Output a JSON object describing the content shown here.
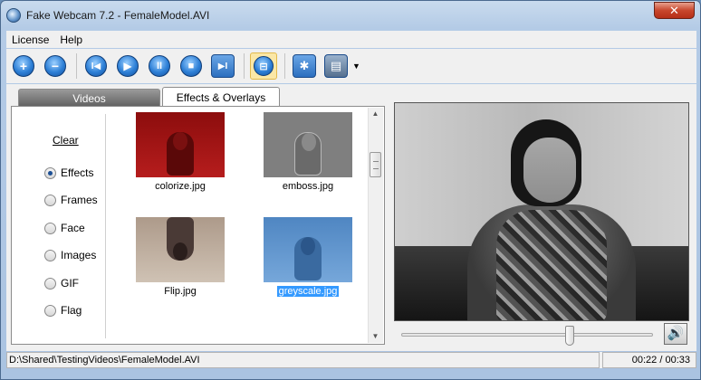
{
  "window": {
    "title": "Fake Webcam 7.2 - FemaleModel.AVI",
    "close_label": "✕"
  },
  "menu": {
    "items": [
      {
        "label": "License"
      },
      {
        "label": "Help"
      }
    ]
  },
  "toolbar": {
    "icons": [
      "add-icon",
      "remove-icon",
      "previous-icon",
      "play-icon",
      "pause-icon",
      "stop-icon",
      "next-icon",
      "fit-icon",
      "settings-icon",
      "film-icon"
    ],
    "glyphs": {
      "add": "+",
      "remove": "−",
      "previous": "I◀",
      "play": "▶",
      "pause": "II",
      "stop": "■",
      "next": "▶I",
      "fit": "⊟",
      "settings": "✱",
      "film": "▤",
      "dropdown": "▼"
    }
  },
  "tabs": [
    {
      "label": "Videos",
      "active": false
    },
    {
      "label": "Effects & Overlays",
      "active": true
    }
  ],
  "effects_panel": {
    "clear_label": "Clear",
    "options": [
      {
        "label": "Effects",
        "checked": true
      },
      {
        "label": "Frames",
        "checked": false
      },
      {
        "label": "Face",
        "checked": false
      },
      {
        "label": "Images",
        "checked": false
      },
      {
        "label": "GIF",
        "checked": false
      },
      {
        "label": "Flag",
        "checked": false
      }
    ],
    "thumbnails": [
      {
        "caption": "colorize.jpg",
        "selected": false
      },
      {
        "caption": "emboss.jpg",
        "selected": false
      },
      {
        "caption": "Flip.jpg",
        "selected": false
      },
      {
        "caption": "greyscale.jpg",
        "selected": true
      }
    ]
  },
  "player": {
    "seek_fraction": 0.67,
    "volume_icon": "🔊"
  },
  "status": {
    "path": "D:\\Shared\\TestingVideos\\FemaleModel.AVI",
    "time": "00:22 / 00:33"
  },
  "colors": {
    "selection": "#3399ff",
    "toolbar_blue": "#2d7fd6"
  }
}
